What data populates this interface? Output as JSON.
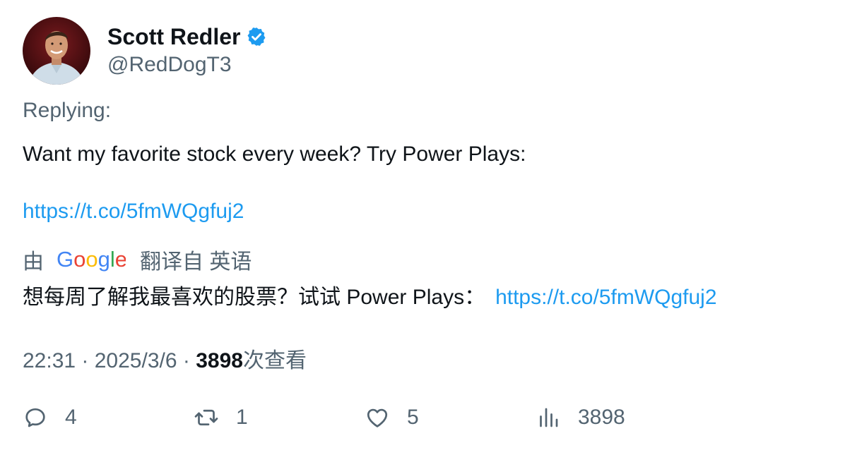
{
  "user": {
    "display_name": "Scott Redler",
    "handle": "@RedDogT3",
    "verified": true
  },
  "tweet": {
    "replying_label": "Replying:",
    "text": "Want my favorite stock every week? Try Power Plays:",
    "link": "https://t.co/5fmWQgfuj2"
  },
  "translation": {
    "by_label": "由",
    "provider": "Google",
    "from_label": "翻译自 英语",
    "text": "想每周了解我最喜欢的股票？试试 Power Plays：",
    "link": "https://t.co/5fmWQgfuj2"
  },
  "meta": {
    "time": "22:31",
    "separator": " · ",
    "date": "2025/3/6",
    "views_count": "3898",
    "views_label": "次查看"
  },
  "actions": {
    "replies": "4",
    "retweets": "1",
    "likes": "5",
    "views": "3898"
  },
  "colors": {
    "text_primary": "#0f1419",
    "text_secondary": "#536471",
    "link": "#1d9bf0",
    "verified": "#1d9bf0"
  },
  "icons": {
    "verified": "verified-badge-icon",
    "reply": "reply-icon",
    "retweet": "retweet-icon",
    "like": "heart-icon",
    "views": "views-chart-icon"
  }
}
